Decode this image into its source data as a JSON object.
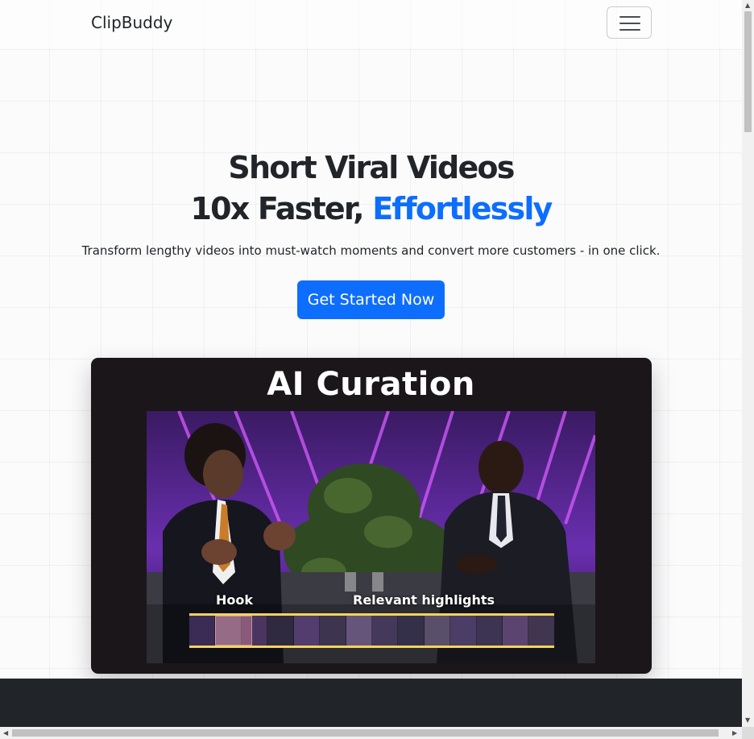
{
  "navbar": {
    "brand": "ClipBuddy",
    "toggler_icon": "hamburger-menu-icon"
  },
  "hero": {
    "title_line1": "Short Viral Videos",
    "title_line2_plain": "10x Faster, ",
    "title_line2_accent": "Effortlessly",
    "subtitle": "Transform lengthy videos into must-watch moments and convert more customers - in one click.",
    "cta_label": "Get Started Now"
  },
  "video": {
    "heading": "AI Curation",
    "timeline_labels": {
      "hook": "Hook",
      "highlights": "Relevant highlights"
    }
  },
  "colors": {
    "accent": "#0d6efd",
    "text": "#212529",
    "video_bg": "#1b1619",
    "timeline_border": "#f4d35e",
    "footer_bg": "#212529"
  }
}
